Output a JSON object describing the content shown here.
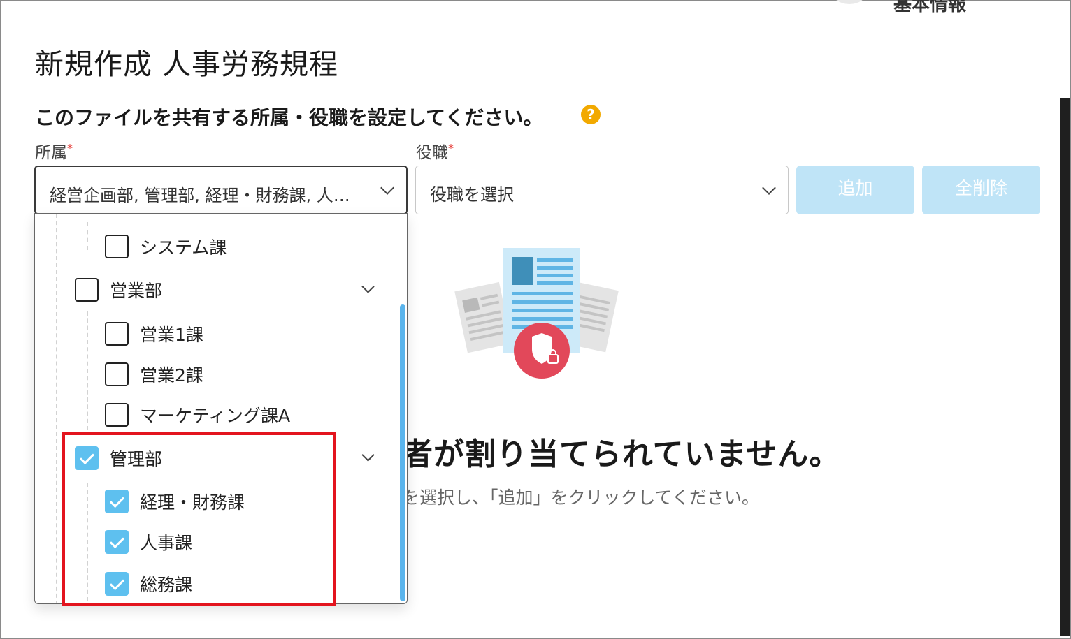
{
  "header": {
    "clipped_tab": "基本情報",
    "title": "新規作成 人事労務規程"
  },
  "form": {
    "instruction": "このファイルを共有する所属・役職を設定してください。",
    "help_icon": "question-icon",
    "department": {
      "label": "所属",
      "required_mark": "*",
      "value": "経営企画部, 管理部, 経理・財務課, 人…"
    },
    "role": {
      "label": "役職",
      "required_mark": "*",
      "placeholder": "役職を選択"
    },
    "add_button": "追加",
    "clear_button": "全削除"
  },
  "dropdown": {
    "items": [
      {
        "label": "システム課",
        "checked": false,
        "level": 2
      },
      {
        "label": "営業部",
        "checked": false,
        "level": 1,
        "expandable": true
      },
      {
        "label": "営業1課",
        "checked": false,
        "level": 2
      },
      {
        "label": "営業2課",
        "checked": false,
        "level": 2
      },
      {
        "label": "マーケティング課A",
        "checked": false,
        "level": 2
      },
      {
        "label": "管理部",
        "checked": true,
        "level": 1,
        "expandable": true
      },
      {
        "label": "経理・財務課",
        "checked": true,
        "level": 2
      },
      {
        "label": "人事課",
        "checked": true,
        "level": 2
      },
      {
        "label": "総務課",
        "checked": true,
        "level": 2
      }
    ]
  },
  "empty_state": {
    "title": "者が割り当てられていません。",
    "subtitle": "を選択し、「追加」をクリックしてください。"
  },
  "colors": {
    "accent": "#5ec0ef",
    "button_disabled": "#bfe4f7",
    "highlight": "#e3141e",
    "help": "#f2a900"
  }
}
